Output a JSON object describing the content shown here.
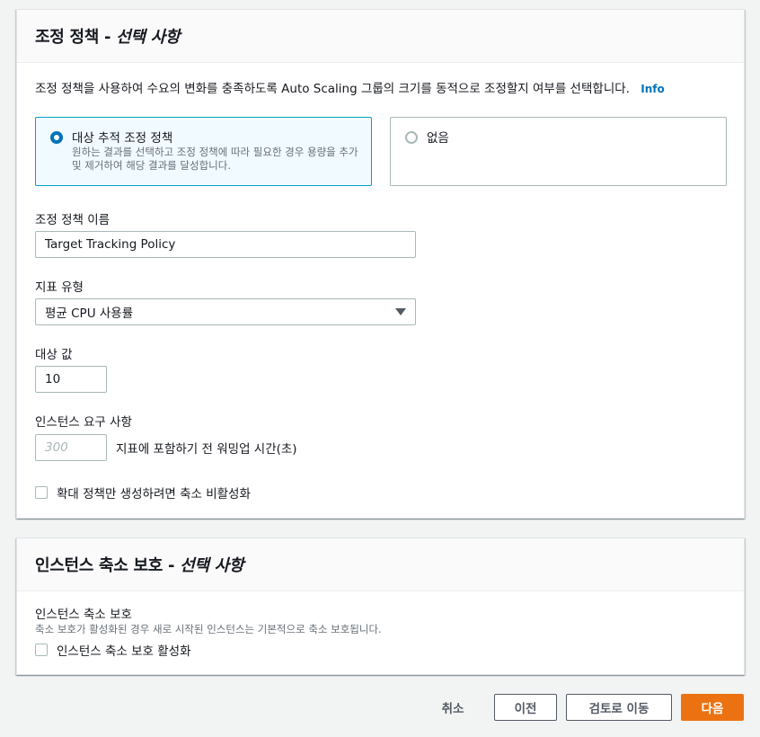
{
  "scaling_policy": {
    "title": "조정 정책 -",
    "optional": "선택 사항",
    "description": "조정 정책을 사용하여 수요의 변화를 충족하도록 Auto Scaling 그룹의 크기를 동적으로 조정할지 여부를 선택합니다.",
    "info_link": "Info",
    "options": [
      {
        "label": "대상 추적 조정 정책",
        "description": "원하는 결과를 선택하고 조정 정책에 따라 필요한 경우 용량을 추가 및 제거하여 해당 결과를 달성합니다.",
        "selected": true
      },
      {
        "label": "없음",
        "selected": false
      }
    ],
    "policy_name_label": "조정 정책 이름",
    "policy_name_value": "Target Tracking Policy",
    "metric_type_label": "지표 유형",
    "metric_type_value": "평균 CPU 사용률",
    "target_value_label": "대상 값",
    "target_value": "10",
    "instance_requirements_label": "인스턴스 요구 사항",
    "warmup_placeholder": "300",
    "warmup_suffix": "지표에 포함하기 전 워밍업 시간(초)",
    "disable_scale_in_label": "확대 정책만 생성하려면 축소 비활성화",
    "disable_scale_in_checked": false
  },
  "scale_in_protection": {
    "title": "인스턴스 축소 보호 -",
    "optional": "선택 사항",
    "field_label": "인스턴스 축소 보호",
    "field_description": "축소 보호가 활성화된 경우 새로 시작된 인스턴스는 기본적으로 축소 보호됩니다.",
    "checkbox_label": "인스턴스 축소 보호 활성화",
    "checked": false
  },
  "footer": {
    "cancel": "취소",
    "previous": "이전",
    "skip_to_review": "검토로 이동",
    "next": "다음"
  },
  "colors": {
    "primary_button": "#ec7211",
    "selected_border": "#00a1c9",
    "radio_checked": "#0073bb",
    "info_link": "#0073bb"
  }
}
